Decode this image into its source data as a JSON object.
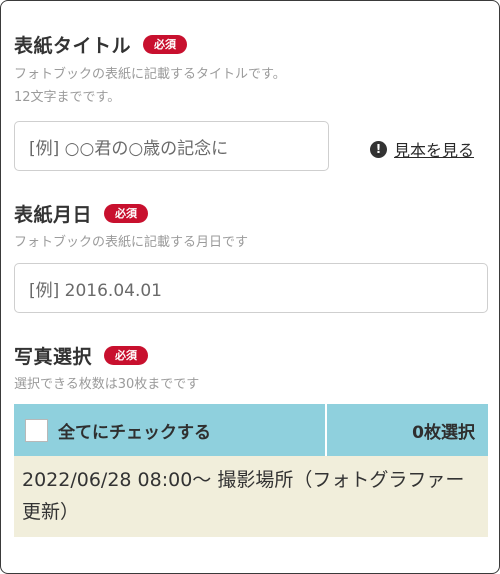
{
  "cover_title": {
    "label": "表紙タイトル",
    "badge": "必須",
    "help_line1": "フォトブックの表紙に記載するタイトルです。",
    "help_line2": "12文字までです。",
    "placeholder": "[例] ○○君の○歳の記念に",
    "sample_link": "見本を見る",
    "sample_icon": "!"
  },
  "cover_date": {
    "label": "表紙月日",
    "badge": "必須",
    "help": "フォトブックの表紙に記載する月日です",
    "placeholder": "[例] 2016.04.01"
  },
  "photo_select": {
    "label": "写真選択",
    "badge": "必須",
    "help": "選択できる枚数は30枚までです",
    "check_all_label": "全てにチェックする",
    "selected_count": "0枚選択",
    "row_text": "2022/06/28 08:00〜 撮影場所（フォトグラファー更新）"
  },
  "colors": {
    "badge": "#c8102e",
    "table_header": "#8fd0dd",
    "table_row": "#f1eedb"
  }
}
